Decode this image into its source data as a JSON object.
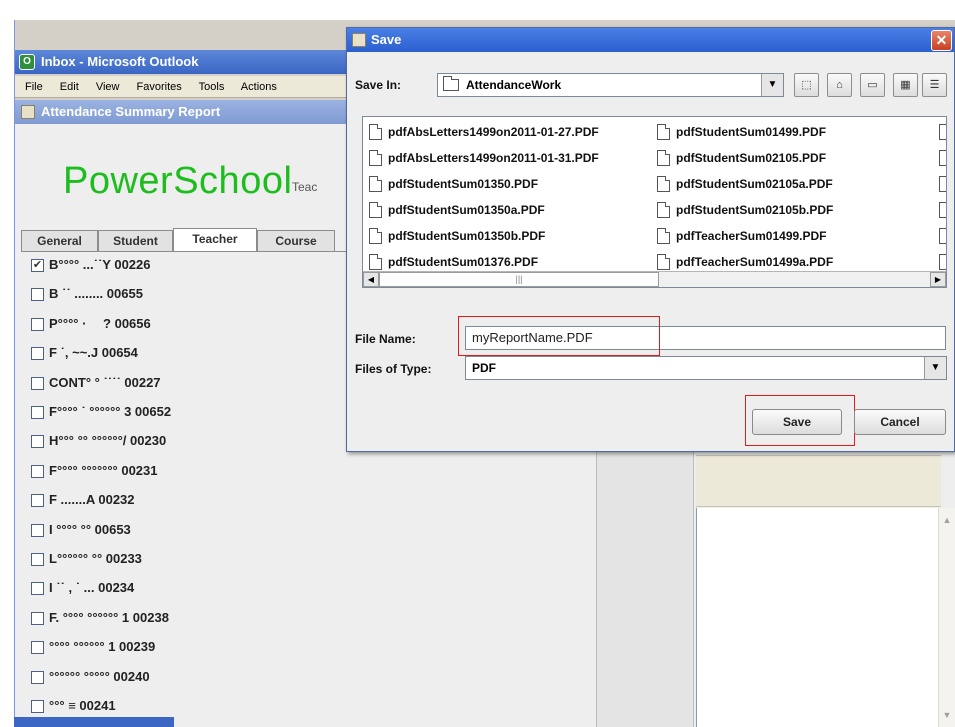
{
  "outlook": {
    "title": "Inbox - Microsoft Outlook",
    "menu": [
      "File",
      "Edit",
      "View",
      "Favorites",
      "Tools",
      "Actions"
    ]
  },
  "report": {
    "title": "Attendance Summary Report",
    "brand": "PowerSchool",
    "brand_sub": "Teac",
    "tabs": [
      "General",
      "Student",
      "Teacher",
      "Course"
    ],
    "active_tab": "Teacher",
    "teachers": [
      {
        "name": "B°°°° ...˙˙Y 00226",
        "checked": true
      },
      {
        "name": "B ˙˙    ........ 00655",
        "checked": false
      },
      {
        "name": "P°°°°   ·       ? 00656",
        "checked": false
      },
      {
        "name": "F ˙, ~~.J 00654",
        "checked": false
      },
      {
        "name": "CONT° °   ˙˙˙˙ 00227",
        "checked": false
      },
      {
        "name": "F°°°° ˙ °°°°°° 3 00652",
        "checked": false
      },
      {
        "name": "H°°° °° °°°°°°/ 00230",
        "checked": false
      },
      {
        "name": "F°°°° °°°°°°° 00231",
        "checked": false
      },
      {
        "name": "F         .......A 00232",
        "checked": false
      },
      {
        "name": "I °°°°           °° 00653",
        "checked": false
      },
      {
        "name": "L°°°°°°         °° 00233",
        "checked": false
      },
      {
        "name": "I       ˙˙ , ˙ ... 00234",
        "checked": false
      },
      {
        "name": "F. °°°° °°°°°° 1 00238",
        "checked": false
      },
      {
        "name": "°°°° °°°°°° 1 00239",
        "checked": false
      },
      {
        "name": "°°°°°°  °°°°° 00240",
        "checked": false
      },
      {
        "name": "°°°       ≡ 00241",
        "checked": false
      }
    ]
  },
  "dialog": {
    "title": "Save",
    "save_in_label": "Save In:",
    "save_in_value": "AttendanceWork",
    "files": [
      "pdfAbsLetters1499on2011-01-27.PDF",
      "pdfAbsLetters1499on2011-01-31.PDF",
      "pdfStudentSum01350.PDF",
      "pdfStudentSum01350a.PDF",
      "pdfStudentSum01350b.PDF",
      "pdfStudentSum01376.PDF",
      "pdfStudentSum01499.PDF",
      "pdfStudentSum02105.PDF",
      "pdfStudentSum02105a.PDF",
      "pdfStudentSum02105b.PDF",
      "pdfTeacherSum01499.PDF",
      "pdfTeacherSum01499a.PDF"
    ],
    "file_name_label": "File Name:",
    "file_name_value": "myReportName.PDF",
    "files_of_type_label": "Files of Type:",
    "files_of_type_value": "PDF",
    "save_button": "Save",
    "cancel_button": "Cancel"
  },
  "colors": {
    "brand_green": "#1ebd1e",
    "title_blue": "#2a5fcf",
    "highlight_red": "#e01b1b"
  }
}
